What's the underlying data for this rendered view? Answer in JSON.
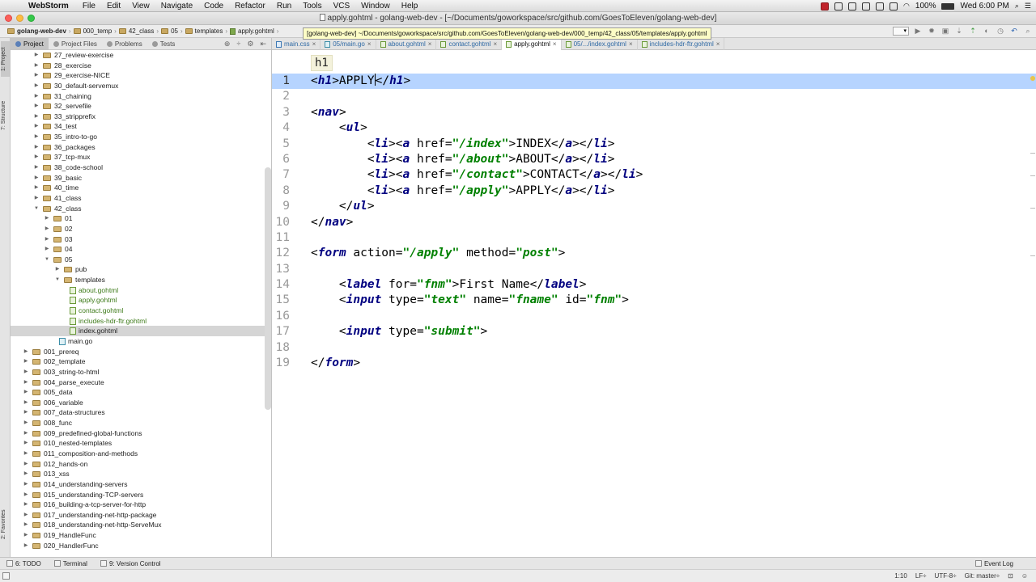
{
  "menubar": {
    "app_name": "WebStorm",
    "items": [
      "File",
      "Edit",
      "View",
      "Navigate",
      "Code",
      "Refactor",
      "Run",
      "Tools",
      "VCS",
      "Window",
      "Help"
    ],
    "battery": "100%",
    "clock": "Wed 6:00 PM"
  },
  "window": {
    "title": "apply.gohtml - golang-web-dev - [~/Documents/goworkspace/src/github.com/GoesToEleven/golang-web-dev]"
  },
  "breadcrumbs": [
    "golang-web-dev",
    "000_temp",
    "42_class",
    "05",
    "templates",
    "apply.gohtml"
  ],
  "tooltip": "[golang-web-dev] ~/Documents/goworkspace/src/github.com/GoesToEleven/golang-web-dev/000_temp/42_class/05/templates/apply.gohtml",
  "left_strip": {
    "project": "1: Project",
    "structure": "7: Structure",
    "favorites": "2: Favorites"
  },
  "panel_tabs": [
    "Project",
    "Project Files",
    "Problems",
    "Tests"
  ],
  "tree": [
    {
      "label": "27_review-exercise",
      "depth": 2,
      "type": "folder",
      "state": "collapsed"
    },
    {
      "label": "28_exercise",
      "depth": 2,
      "type": "folder",
      "state": "collapsed"
    },
    {
      "label": "29_exercise-NICE",
      "depth": 2,
      "type": "folder",
      "state": "collapsed"
    },
    {
      "label": "30_default-servemux",
      "depth": 2,
      "type": "folder",
      "state": "collapsed"
    },
    {
      "label": "31_chaining",
      "depth": 2,
      "type": "folder",
      "state": "collapsed"
    },
    {
      "label": "32_servefile",
      "depth": 2,
      "type": "folder",
      "state": "collapsed"
    },
    {
      "label": "33_stripprefix",
      "depth": 2,
      "type": "folder",
      "state": "collapsed"
    },
    {
      "label": "34_test",
      "depth": 2,
      "type": "folder",
      "state": "collapsed"
    },
    {
      "label": "35_intro-to-go",
      "depth": 2,
      "type": "folder",
      "state": "collapsed"
    },
    {
      "label": "36_packages",
      "depth": 2,
      "type": "folder",
      "state": "collapsed"
    },
    {
      "label": "37_tcp-mux",
      "depth": 2,
      "type": "folder",
      "state": "collapsed"
    },
    {
      "label": "38_code-school",
      "depth": 2,
      "type": "folder",
      "state": "collapsed"
    },
    {
      "label": "39_basic",
      "depth": 2,
      "type": "folder",
      "state": "collapsed"
    },
    {
      "label": "40_time",
      "depth": 2,
      "type": "folder",
      "state": "collapsed"
    },
    {
      "label": "41_class",
      "depth": 2,
      "type": "folder",
      "state": "collapsed"
    },
    {
      "label": "42_class",
      "depth": 2,
      "type": "folder",
      "state": "expanded"
    },
    {
      "label": "01",
      "depth": 3,
      "type": "folder",
      "state": "collapsed"
    },
    {
      "label": "02",
      "depth": 3,
      "type": "folder",
      "state": "collapsed"
    },
    {
      "label": "03",
      "depth": 3,
      "type": "folder",
      "state": "collapsed"
    },
    {
      "label": "04",
      "depth": 3,
      "type": "folder",
      "state": "collapsed"
    },
    {
      "label": "05",
      "depth": 3,
      "type": "folder",
      "state": "expanded"
    },
    {
      "label": "pub",
      "depth": 4,
      "type": "folder",
      "state": "collapsed"
    },
    {
      "label": "templates",
      "depth": 4,
      "type": "folder",
      "state": "expanded"
    },
    {
      "label": "about.gohtml",
      "depth": 5,
      "type": "gohtml"
    },
    {
      "label": "apply.gohtml",
      "depth": 5,
      "type": "gohtml"
    },
    {
      "label": "contact.gohtml",
      "depth": 5,
      "type": "gohtml"
    },
    {
      "label": "includes-hdr-ftr.gohtml",
      "depth": 5,
      "type": "gohtml"
    },
    {
      "label": "index.gohtml",
      "depth": 5,
      "type": "gohtml-plain",
      "selected": true
    },
    {
      "label": "main.go",
      "depth": 4,
      "type": "go"
    },
    {
      "label": "001_prereq",
      "depth": 1,
      "type": "folder",
      "state": "collapsed"
    },
    {
      "label": "002_template",
      "depth": 1,
      "type": "folder",
      "state": "collapsed"
    },
    {
      "label": "003_string-to-html",
      "depth": 1,
      "type": "folder",
      "state": "collapsed"
    },
    {
      "label": "004_parse_execute",
      "depth": 1,
      "type": "folder",
      "state": "collapsed"
    },
    {
      "label": "005_data",
      "depth": 1,
      "type": "folder",
      "state": "collapsed"
    },
    {
      "label": "006_variable",
      "depth": 1,
      "type": "folder",
      "state": "collapsed"
    },
    {
      "label": "007_data-structures",
      "depth": 1,
      "type": "folder",
      "state": "collapsed"
    },
    {
      "label": "008_func",
      "depth": 1,
      "type": "folder",
      "state": "collapsed"
    },
    {
      "label": "009_predefined-global-functions",
      "depth": 1,
      "type": "folder",
      "state": "collapsed"
    },
    {
      "label": "010_nested-templates",
      "depth": 1,
      "type": "folder",
      "state": "collapsed"
    },
    {
      "label": "011_composition-and-methods",
      "depth": 1,
      "type": "folder",
      "state": "collapsed"
    },
    {
      "label": "012_hands-on",
      "depth": 1,
      "type": "folder",
      "state": "collapsed"
    },
    {
      "label": "013_xss",
      "depth": 1,
      "type": "folder",
      "state": "collapsed"
    },
    {
      "label": "014_understanding-servers",
      "depth": 1,
      "type": "folder",
      "state": "collapsed"
    },
    {
      "label": "015_understanding-TCP-servers",
      "depth": 1,
      "type": "folder",
      "state": "collapsed"
    },
    {
      "label": "016_building-a-tcp-server-for-http",
      "depth": 1,
      "type": "folder",
      "state": "collapsed"
    },
    {
      "label": "017_understanding-net-http-package",
      "depth": 1,
      "type": "folder",
      "state": "collapsed"
    },
    {
      "label": "018_understanding-net-http-ServeMux",
      "depth": 1,
      "type": "folder",
      "state": "collapsed"
    },
    {
      "label": "019_HandleFunc",
      "depth": 1,
      "type": "folder",
      "state": "collapsed"
    },
    {
      "label": "020_HandlerFunc",
      "depth": 1,
      "type": "folder",
      "state": "collapsed"
    }
  ],
  "editor_tabs": [
    {
      "label": "main.css",
      "kind": "css",
      "active": false
    },
    {
      "label": "05/main.go",
      "kind": "go",
      "active": false
    },
    {
      "label": "about.gohtml",
      "kind": "gohtml",
      "active": false
    },
    {
      "label": "contact.gohtml",
      "kind": "gohtml",
      "active": false
    },
    {
      "label": "apply.gohtml",
      "kind": "gohtml",
      "active": true
    },
    {
      "label": "05/.../index.gohtml",
      "kind": "gohtml",
      "active": false
    },
    {
      "label": "includes-hdr-ftr.gohtml",
      "kind": "gohtml",
      "active": false
    }
  ],
  "editor": {
    "breadcrumb_hint": "h1",
    "current_line": 1,
    "lines": [
      [
        [
          "p",
          "<"
        ],
        [
          "t",
          "h1"
        ],
        [
          "p",
          ">APPLY"
        ],
        [
          "c",
          ""
        ],
        [
          "p",
          "</"
        ],
        [
          "t",
          "h1"
        ],
        [
          "p",
          ">"
        ]
      ],
      [],
      [
        [
          "p",
          "<"
        ],
        [
          "t",
          "nav"
        ],
        [
          "p",
          ">"
        ]
      ],
      [
        [
          "p",
          "    <"
        ],
        [
          "t",
          "ul"
        ],
        [
          "p",
          ">"
        ]
      ],
      [
        [
          "p",
          "        <"
        ],
        [
          "t",
          "li"
        ],
        [
          "p",
          "><"
        ],
        [
          "t",
          "a"
        ],
        [
          "p",
          " href="
        ],
        [
          "s",
          "\"/index\""
        ],
        [
          "p",
          ">INDEX</"
        ],
        [
          "t",
          "a"
        ],
        [
          "p",
          "></"
        ],
        [
          "t",
          "li"
        ],
        [
          "p",
          ">"
        ]
      ],
      [
        [
          "p",
          "        <"
        ],
        [
          "t",
          "li"
        ],
        [
          "p",
          "><"
        ],
        [
          "t",
          "a"
        ],
        [
          "p",
          " href="
        ],
        [
          "s",
          "\"/about\""
        ],
        [
          "p",
          ">ABOUT</"
        ],
        [
          "t",
          "a"
        ],
        [
          "p",
          "></"
        ],
        [
          "t",
          "li"
        ],
        [
          "p",
          ">"
        ]
      ],
      [
        [
          "p",
          "        <"
        ],
        [
          "t",
          "li"
        ],
        [
          "p",
          "><"
        ],
        [
          "t",
          "a"
        ],
        [
          "p",
          " href="
        ],
        [
          "s",
          "\"/contact\""
        ],
        [
          "p",
          ">CONTACT</"
        ],
        [
          "t",
          "a"
        ],
        [
          "p",
          "></"
        ],
        [
          "t",
          "li"
        ],
        [
          "p",
          ">"
        ]
      ],
      [
        [
          "p",
          "        <"
        ],
        [
          "t",
          "li"
        ],
        [
          "p",
          "><"
        ],
        [
          "t",
          "a"
        ],
        [
          "p",
          " href="
        ],
        [
          "s",
          "\"/apply\""
        ],
        [
          "p",
          ">APPLY</"
        ],
        [
          "t",
          "a"
        ],
        [
          "p",
          "></"
        ],
        [
          "t",
          "li"
        ],
        [
          "p",
          ">"
        ]
      ],
      [
        [
          "p",
          "    </"
        ],
        [
          "t",
          "ul"
        ],
        [
          "p",
          ">"
        ]
      ],
      [
        [
          "p",
          "</"
        ],
        [
          "t",
          "nav"
        ],
        [
          "p",
          ">"
        ]
      ],
      [],
      [
        [
          "p",
          "<"
        ],
        [
          "t",
          "form"
        ],
        [
          "p",
          " action="
        ],
        [
          "s",
          "\"/apply\""
        ],
        [
          "p",
          " method="
        ],
        [
          "s",
          "\"post\""
        ],
        [
          "p",
          ">"
        ]
      ],
      [],
      [
        [
          "p",
          "    <"
        ],
        [
          "t",
          "label"
        ],
        [
          "p",
          " for="
        ],
        [
          "s",
          "\"fnm\""
        ],
        [
          "p",
          ">First Name</"
        ],
        [
          "t",
          "label"
        ],
        [
          "p",
          ">"
        ]
      ],
      [
        [
          "p",
          "    <"
        ],
        [
          "t",
          "input"
        ],
        [
          "p",
          " type="
        ],
        [
          "s",
          "\"text\""
        ],
        [
          "p",
          " name="
        ],
        [
          "s",
          "\"fname\""
        ],
        [
          "p",
          " id="
        ],
        [
          "s",
          "\"fnm\""
        ],
        [
          "p",
          ">"
        ]
      ],
      [],
      [
        [
          "p",
          "    <"
        ],
        [
          "t",
          "input"
        ],
        [
          "p",
          " type="
        ],
        [
          "s",
          "\"submit\""
        ],
        [
          "p",
          ">"
        ]
      ],
      [],
      [
        [
          "p",
          "</"
        ],
        [
          "t",
          "form"
        ],
        [
          "p",
          ">"
        ]
      ]
    ]
  },
  "bottom_tabs": [
    "6: TODO",
    "Terminal",
    "9: Version Control"
  ],
  "event_log": "Event Log",
  "status": {
    "position": "1:10",
    "line_sep": "LF÷",
    "encoding": "UTF-8÷",
    "vcs": "Git: master÷"
  },
  "colors": {
    "selection": "#b6d4ff",
    "tag": "#000080",
    "string": "#008000",
    "gohtml_file": "#3d7a19"
  }
}
